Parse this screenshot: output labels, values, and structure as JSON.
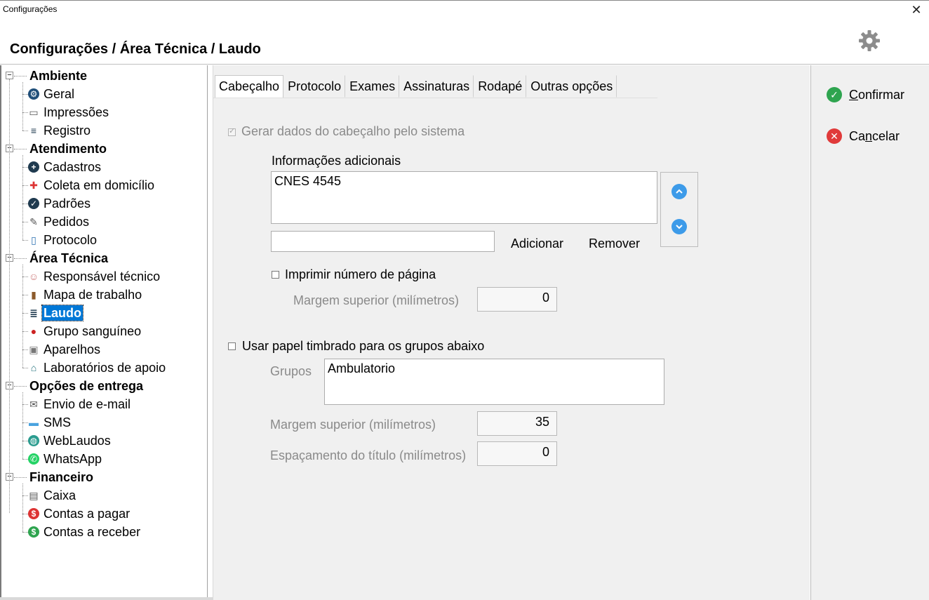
{
  "window": {
    "title": "Configurações",
    "close_glyph": "✕"
  },
  "header": {
    "title": "Configurações / Área Técnica / Laudo",
    "settings_icon": "gear-icon"
  },
  "sidebar": {
    "categories": [
      {
        "label": "Ambiente",
        "items": [
          {
            "label": "Geral",
            "icon": "gear-icon"
          },
          {
            "label": "Impressões",
            "icon": "printer-icon"
          },
          {
            "label": "Registro",
            "icon": "document-icon"
          }
        ]
      },
      {
        "label": "Atendimento",
        "items": [
          {
            "label": "Cadastros",
            "icon": "plus-circle-icon"
          },
          {
            "label": "Coleta em domicílio",
            "icon": "ambulance-icon"
          },
          {
            "label": "Padrões",
            "icon": "check-circle-icon"
          },
          {
            "label": "Pedidos",
            "icon": "edit-document-icon"
          },
          {
            "label": "Protocolo",
            "icon": "page-icon"
          }
        ]
      },
      {
        "label": "Área Técnica",
        "items": [
          {
            "label": "Responsável técnico",
            "icon": "person-icon"
          },
          {
            "label": "Mapa de trabalho",
            "icon": "book-icon"
          },
          {
            "label": "Laudo",
            "icon": "report-icon",
            "selected": true
          },
          {
            "label": "Grupo sanguíneo",
            "icon": "blood-drop-icon"
          },
          {
            "label": "Aparelhos",
            "icon": "device-icon"
          },
          {
            "label": "Laboratórios de apoio",
            "icon": "microscope-icon"
          }
        ]
      },
      {
        "label": "Opções de entrega",
        "items": [
          {
            "label": "Envio de e-mail",
            "icon": "envelope-icon"
          },
          {
            "label": "SMS",
            "icon": "sms-icon"
          },
          {
            "label": "WebLaudos",
            "icon": "globe-icon"
          },
          {
            "label": "WhatsApp",
            "icon": "whatsapp-icon"
          }
        ]
      },
      {
        "label": "Financeiro",
        "items": [
          {
            "label": "Caixa",
            "icon": "cash-register-icon"
          },
          {
            "label": "Contas a pagar",
            "icon": "dollar-red-icon"
          },
          {
            "label": "Contas a receber",
            "icon": "dollar-green-icon"
          }
        ]
      }
    ]
  },
  "tabs": [
    "Cabeçalho",
    "Protocolo",
    "Exames",
    "Assinaturas",
    "Rodapé",
    "Outras opções"
  ],
  "active_tab": "Cabeçalho",
  "form": {
    "generate_header_label": "Gerar dados do cabeçalho pelo sistema",
    "generate_header_checked": true,
    "additional_info_label": "Informações adicionais",
    "additional_info_items": [
      "CNES 4545"
    ],
    "new_item_value": "",
    "add_label": "Adicionar",
    "remove_label": "Remover",
    "print_page_number_label": "Imprimir número de página",
    "print_page_number_checked": false,
    "top_margin_label": "Margem superior (milímetros)",
    "top_margin_value": "0",
    "letterhead_label": "Usar papel timbrado para os grupos abaixo",
    "letterhead_checked": false,
    "groups_label": "Grupos",
    "groups_value": "Ambulatorio",
    "letterhead_margin_label": "Margem superior (milímetros)",
    "letterhead_margin_value": "35",
    "title_spacing_label": "Espaçamento do título (milímetros)",
    "title_spacing_value": "0"
  },
  "actions": {
    "confirm_label": "Confirmar",
    "confirm_mnemonic": "C",
    "cancel_label": "Cancelar",
    "cancel_mnemonic": "n",
    "confirm_color": "#2ea44f",
    "cancel_color": "#e03a3a"
  },
  "colors": {
    "selection": "#0078d7",
    "panel": "#f0f0f0",
    "arrow_button": "#3d9be9"
  }
}
